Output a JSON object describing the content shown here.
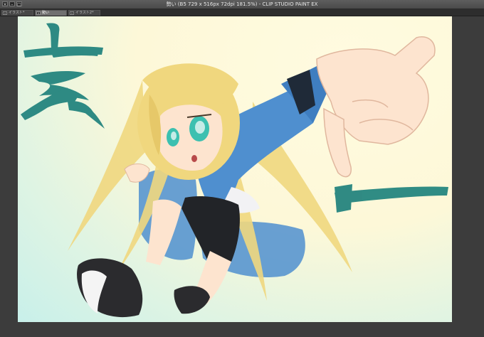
{
  "window": {
    "title": "勢い (B5 729 x 516px 72dpi 181.5%)  - CLIP STUDIO PAINT EX",
    "controls": [
      "close-icon",
      "minimize-icon",
      "maximize-icon"
    ]
  },
  "tabs": [
    {
      "label": "イラスト*",
      "active": false
    },
    {
      "label": "勢い",
      "active": true
    },
    {
      "label": "イラスト2*",
      "active": false
    }
  ],
  "canvas": {
    "artwork": "anime-girl-illustration",
    "colors": {
      "background_warm": "#fdf8d8",
      "background_cool": "#c8f0ea",
      "hair": "#f0d77e",
      "jacket": "#4f8fcf",
      "brush": "#1a7f7a",
      "skin": "#fde4cf"
    }
  }
}
